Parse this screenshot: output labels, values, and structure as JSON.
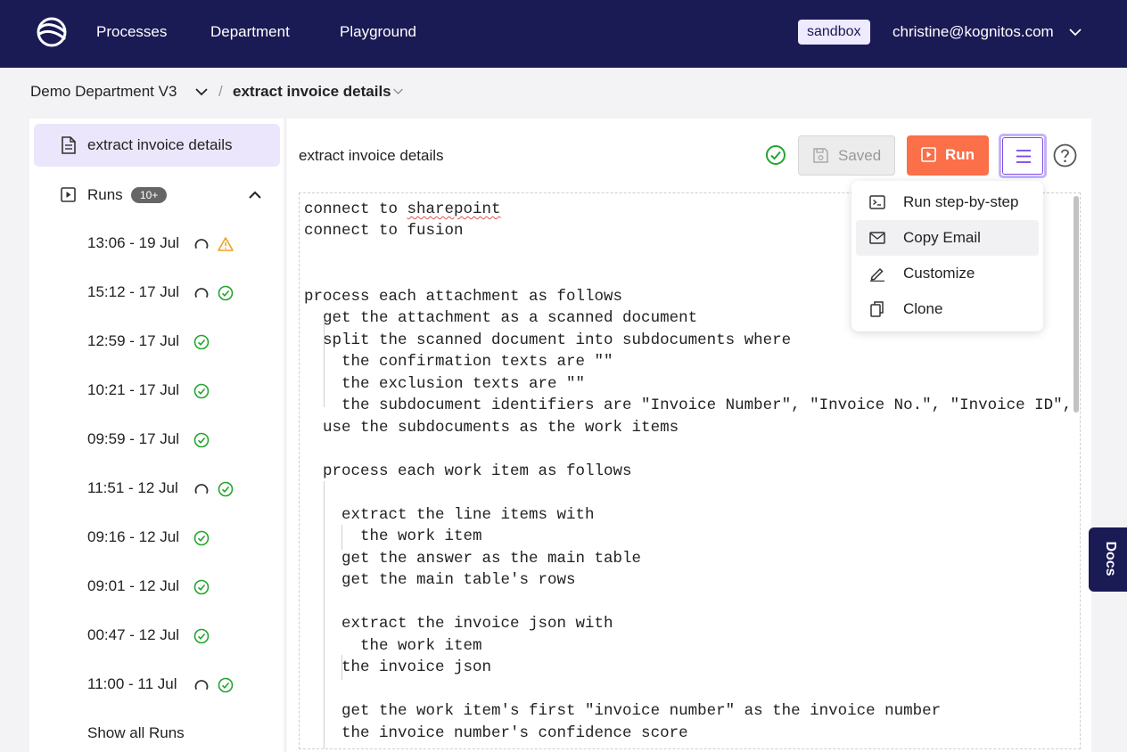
{
  "nav": {
    "links": [
      "Processes",
      "Department",
      "Playground"
    ],
    "env_badge": "sandbox",
    "user_email": "christine@kognitos.com"
  },
  "breadcrumb": {
    "department": "Demo Department V3",
    "separator": "/",
    "process": "extract invoice details"
  },
  "sidebar": {
    "active_item": "extract invoice details",
    "runs_label": "Runs",
    "runs_count": "10+",
    "runs": [
      {
        "time": "13:06 - 19 Jul",
        "status": [
          "running",
          "warning"
        ]
      },
      {
        "time": "15:12 - 17 Jul",
        "status": [
          "running",
          "success"
        ]
      },
      {
        "time": "12:59 - 17 Jul",
        "status": [
          "success"
        ]
      },
      {
        "time": "10:21 - 17 Jul",
        "status": [
          "success"
        ]
      },
      {
        "time": "09:59 - 17 Jul",
        "status": [
          "success"
        ]
      },
      {
        "time": "11:51 - 12 Jul",
        "status": [
          "running",
          "success"
        ]
      },
      {
        "time": "09:16 - 12 Jul",
        "status": [
          "success"
        ]
      },
      {
        "time": "09:01 - 12 Jul",
        "status": [
          "success"
        ]
      },
      {
        "time": "00:47 - 12 Jul",
        "status": [
          "success"
        ]
      },
      {
        "time": "11:00 - 11 Jul",
        "status": [
          "running",
          "success"
        ]
      }
    ],
    "show_all": "Show all Runs"
  },
  "toolbar": {
    "title": "extract invoice details",
    "saved_label": "Saved",
    "run_label": "Run"
  },
  "menu": {
    "items": [
      "Run step-by-step",
      "Copy Email",
      "Customize",
      "Clone"
    ],
    "highlighted": "Copy Email"
  },
  "editor": {
    "lines": [
      "connect to sharepoint",
      "connect to fusion",
      "",
      "",
      "process each attachment as follows",
      "  get the attachment as a scanned document",
      "  split the scanned document into subdocuments where",
      "    the confirmation texts are \"\"",
      "    the exclusion texts are \"\"",
      "    the subdocument identifiers are \"Invoice Number\", \"Invoice No.\", \"Invoice ID\",",
      "  use the subdocuments as the work items",
      "",
      "  process each work item as follows",
      "",
      "    extract the line items with",
      "      the work item",
      "    get the answer as the main table",
      "    get the main table's rows",
      "",
      "    extract the invoice json with",
      "      the work item",
      "    the invoice json",
      "",
      "    get the work item's first \"invoice number\" as the invoice number",
      "    the invoice number's confidence score"
    ]
  },
  "docs_tab": "Docs",
  "colors": {
    "nav_bg": "#1a1a55",
    "accent": "#7b46e6",
    "run_button": "#fb6f49",
    "success": "#22a52e",
    "warning": "#f0a020"
  }
}
